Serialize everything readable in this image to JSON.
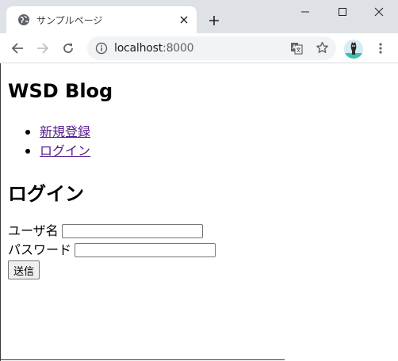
{
  "browser": {
    "tab_title": "サンプルページ",
    "url_host": "localhost",
    "url_port": ":8000"
  },
  "page": {
    "heading": "WSD Blog",
    "nav": [
      {
        "label": "新規登録"
      },
      {
        "label": "ログイン"
      }
    ],
    "section_title": "ログイン",
    "form": {
      "username_label": "ユーザ名",
      "username_value": "",
      "password_label": "パスワード",
      "password_value": "",
      "submit_label": "送信"
    }
  },
  "colors": {
    "link": "#551a8b",
    "tabstrip": "#dee1e6",
    "omnibox": "#f1f3f4"
  },
  "icons": [
    "globe-icon",
    "close-icon",
    "plus-icon",
    "minimize-icon",
    "maximize-icon",
    "window-close-icon",
    "back-arrow-icon",
    "forward-arrow-icon",
    "reload-icon",
    "info-icon",
    "translate-icon",
    "star-icon",
    "avatar",
    "menu-dots-icon"
  ]
}
